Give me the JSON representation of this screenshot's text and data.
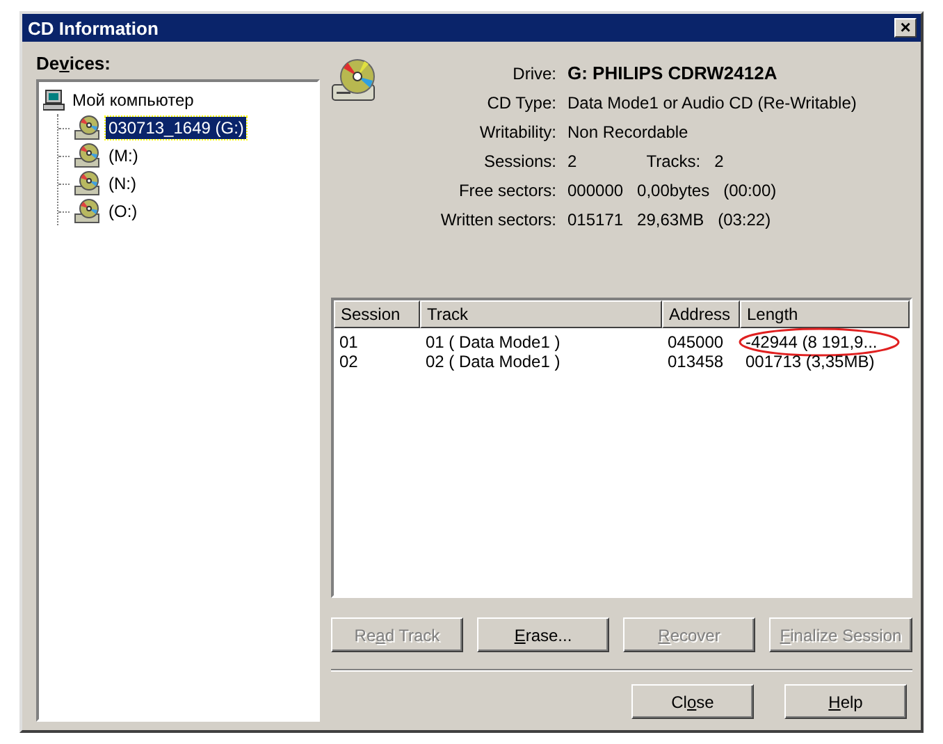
{
  "window": {
    "title": "CD Information",
    "close_glyph": "×"
  },
  "devices": {
    "label": {
      "pre": "De",
      "key": "v",
      "rest": "ices:"
    },
    "tree": [
      {
        "label": "Мой компьютер",
        "kind": "computer",
        "selected": false,
        "children": [
          {
            "label": "030713_1649 (G:)",
            "kind": "cd",
            "selected": true
          },
          {
            "label": "(M:)",
            "kind": "cd",
            "selected": false
          },
          {
            "label": "(N:)",
            "kind": "cd",
            "selected": false
          },
          {
            "label": "(O:)",
            "kind": "cd",
            "selected": false
          }
        ]
      }
    ]
  },
  "info": [
    {
      "label": "Drive:",
      "values": [
        "G: PHILIPS CDRW2412A"
      ],
      "bold": true
    },
    {
      "label": "CD Type:",
      "values": [
        "Data Mode1 or Audio CD (Re-Writable)"
      ],
      "bold": false
    },
    {
      "label": "Writability:",
      "values": [
        "Non Recordable"
      ],
      "bold": false
    },
    {
      "label": "Sessions:",
      "values": [
        "2",
        "Tracks:",
        "2"
      ],
      "bold": false
    },
    {
      "label": "Free sectors:",
      "values": [
        "000000",
        "0,00bytes",
        "(00:00)"
      ],
      "bold": false
    },
    {
      "label": "Written sectors:",
      "values": [
        "015171",
        "29,63MB",
        "(03:22)"
      ],
      "bold": false
    }
  ],
  "table": {
    "columns": [
      "Session",
      "Track",
      "Address",
      "Length"
    ],
    "rows": [
      {
        "cells": [
          "01",
          "01 ( Data Mode1 )",
          "045000",
          "-42944 (8 191,9..."
        ],
        "highlighted": true
      },
      {
        "cells": [
          "02",
          "02 ( Data Mode1 )",
          "013458",
          "001713 (3,35MB)"
        ],
        "highlighted": false
      }
    ]
  },
  "actions": [
    {
      "pre": "Re",
      "key": "a",
      "rest": "d Track",
      "disabled": true
    },
    {
      "key": "E",
      "rest": "rase...",
      "disabled": false
    },
    {
      "key": "R",
      "rest": "ecover",
      "disabled": true
    },
    {
      "key": "F",
      "rest": "inalize Session",
      "disabled": true
    }
  ],
  "buttons": [
    {
      "pre": "Cl",
      "key": "o",
      "rest": "se",
      "disabled": false
    },
    {
      "key": "H",
      "rest": "elp",
      "disabled": false
    }
  ]
}
